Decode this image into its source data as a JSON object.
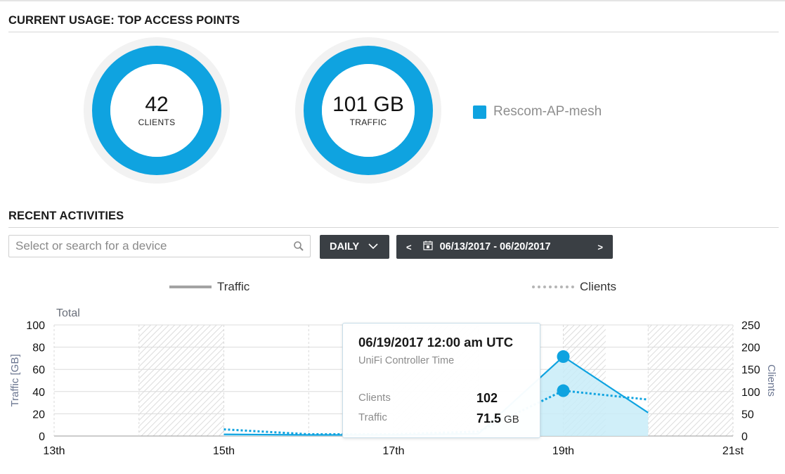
{
  "current_usage": {
    "title": "CURRENT USAGE: TOP ACCESS POINTS",
    "clients_value": "42",
    "clients_label": "CLIENTS",
    "traffic_value": "101 GB",
    "traffic_label": "TRAFFIC",
    "legend_label": "Rescom-AP-mesh",
    "accent_color": "#0fa3e0"
  },
  "recent": {
    "title": "RECENT ACTIVITIES",
    "search_placeholder": "Select or search for a device",
    "period_label": "DAILY",
    "date_range": "06/13/2017 - 06/20/2017",
    "prev_label": "<",
    "next_label": ">"
  },
  "chart_data": {
    "type": "line",
    "legend": [
      "Traffic",
      "Clients"
    ],
    "title": "Total",
    "ylabel_left": "Traffic [GB]",
    "ylabel_right": "Clients",
    "x_ticks": [
      "13th",
      "15th",
      "17th",
      "19th",
      "21st"
    ],
    "ylim_left": [
      0,
      100
    ],
    "ylim_right": [
      0,
      250
    ],
    "y_ticks_left": [
      "100",
      "80",
      "60",
      "40",
      "20",
      "0"
    ],
    "y_ticks_right": [
      "250",
      "200",
      "150",
      "100",
      "50",
      "0"
    ],
    "x_range": [
      13,
      21
    ],
    "series": [
      {
        "name": "Traffic",
        "x": [
          15,
          16,
          17,
          18,
          19,
          20
        ],
        "values": [
          1.5,
          1,
          1,
          2,
          71.5,
          21
        ]
      },
      {
        "name": "Clients",
        "x": [
          15,
          16,
          17,
          18,
          19,
          20
        ],
        "values": [
          15,
          4,
          4,
          10,
          102,
          82
        ]
      }
    ],
    "shaded_days": [
      [
        14,
        15
      ],
      [
        17,
        18
      ],
      [
        19,
        19.5
      ],
      [
        20,
        21
      ]
    ],
    "colors": {
      "line": "#0fa3e0",
      "fill": "#c8ecf8",
      "shade": "#e0e0e0"
    }
  },
  "tooltip": {
    "date": "06/19/2017 12:00 am UTC",
    "subtitle": "UniFi Controller Time",
    "clients_label": "Clients",
    "clients_value": "102",
    "traffic_label": "Traffic",
    "traffic_value": "71.5",
    "traffic_unit": "GB"
  }
}
